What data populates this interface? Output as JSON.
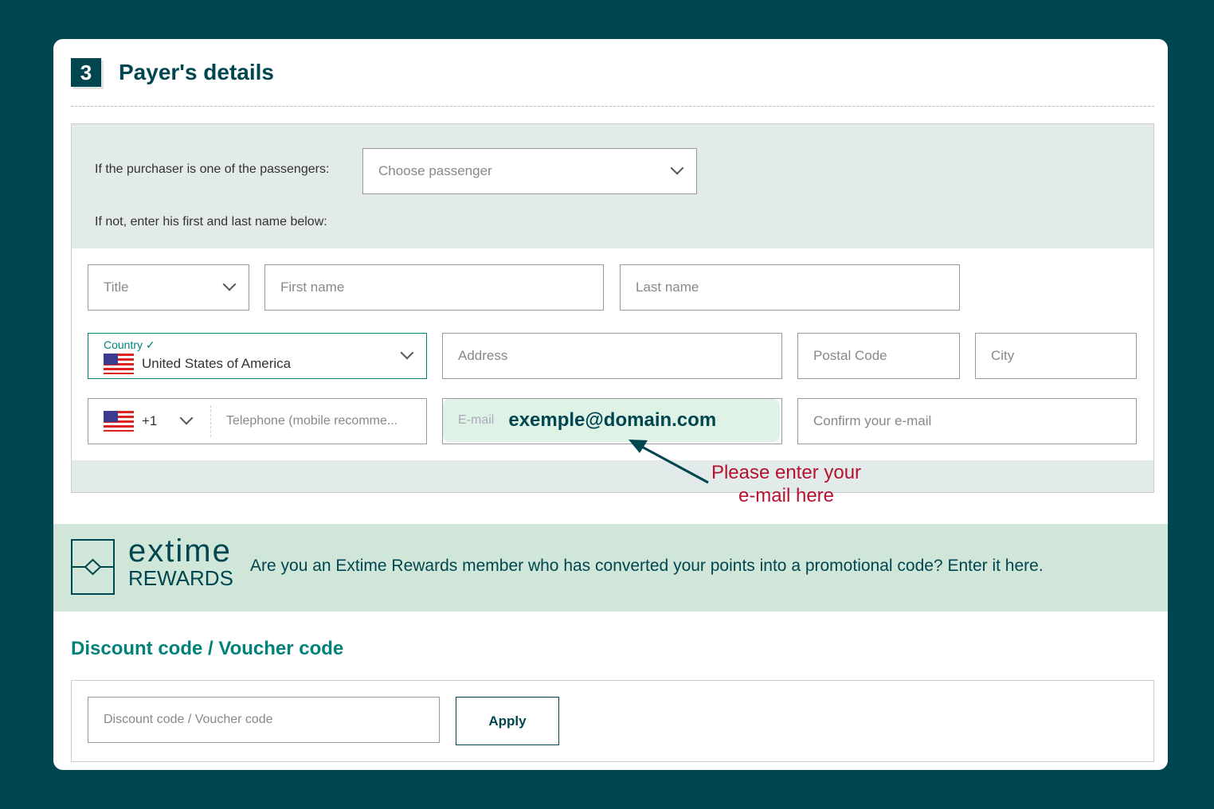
{
  "section": {
    "step": "3",
    "title": "Payer's details"
  },
  "purchaser": {
    "label": "If the purchaser is one of the passengers:",
    "select_placeholder": "Choose passenger",
    "hint": "If not, enter his first and last name below:"
  },
  "form": {
    "title_placeholder": "Title",
    "first_name_placeholder": "First name",
    "last_name_placeholder": "Last name",
    "country_label": "Country",
    "country_value": "United States of America",
    "address_placeholder": "Address",
    "postal_placeholder": "Postal Code",
    "city_placeholder": "City",
    "phone_code": "+1",
    "phone_placeholder": "Telephone (mobile recomme...",
    "email_label": "E-mail",
    "email_value": "exemple@domain.com",
    "confirm_email_placeholder": "Confirm your e-mail"
  },
  "annotation": {
    "line1": "Please enter your",
    "line2": "e-mail here",
    "color": "#b5122d"
  },
  "rewards": {
    "logo_top": "extime",
    "logo_bottom": "REWARDS",
    "text": "Are you an Extime Rewards member who has converted your points into a promotional code? Enter it here."
  },
  "discount": {
    "title": "Discount code / Voucher code",
    "placeholder": "Discount code / Voucher code",
    "apply_label": "Apply"
  },
  "colors": {
    "brand": "#004650",
    "accent": "#00817a"
  }
}
